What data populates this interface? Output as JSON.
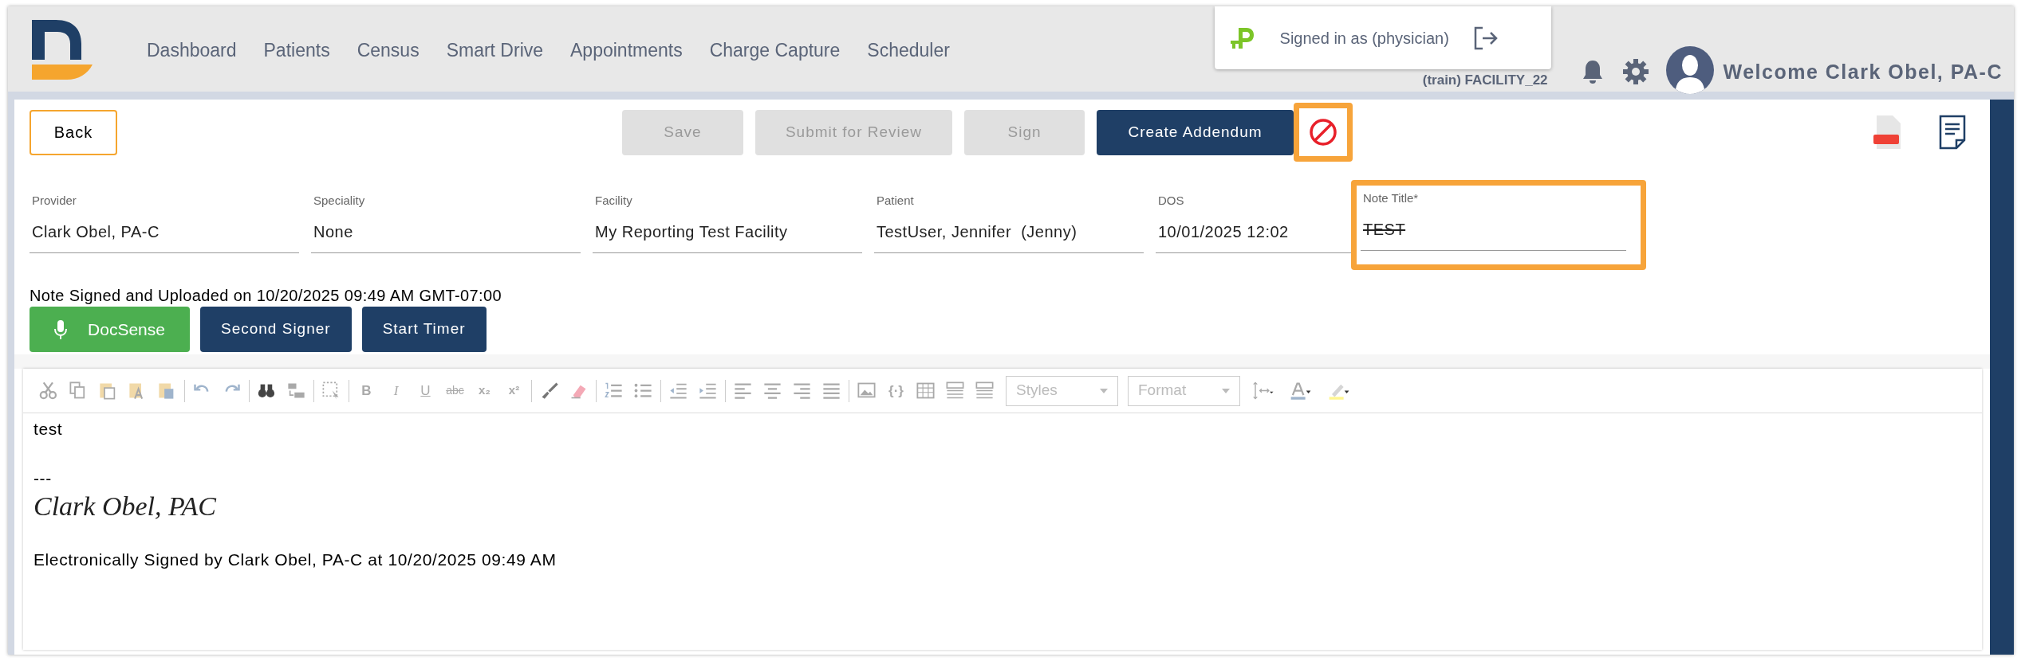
{
  "header": {
    "nav": [
      {
        "label": "Dashboard"
      },
      {
        "label": "Patients"
      },
      {
        "label": "Census"
      },
      {
        "label": "Smart Drive"
      },
      {
        "label": "Appointments"
      },
      {
        "label": "Charge Capture"
      },
      {
        "label": "Scheduler"
      }
    ],
    "signed_in": "Signed in as (physician)",
    "facility": "(train) FACILITY_22",
    "welcome": "Welcome Clark Obel, PA-C"
  },
  "actions": {
    "back": "Back",
    "buttons": [
      {
        "label": "Save",
        "disabled": true
      },
      {
        "label": "Submit for Review",
        "disabled": true
      },
      {
        "label": "Sign",
        "disabled": true
      },
      {
        "label": "Create Addendum",
        "disabled": false
      }
    ],
    "ban_highlighted": true
  },
  "fields": [
    {
      "label": "Provider",
      "value": "Clark Obel, PA-C",
      "highlighted": false,
      "struck": false
    },
    {
      "label": "Speciality",
      "value": "None",
      "highlighted": false,
      "struck": false
    },
    {
      "label": "Facility",
      "value": "My Reporting Test Facility",
      "highlighted": false,
      "struck": false
    },
    {
      "label": "Patient",
      "value": "TestUser, Jennifer  (Jenny)",
      "highlighted": false,
      "struck": false
    },
    {
      "label": "DOS",
      "value": "10/01/2025 12:02",
      "highlighted": false,
      "struck": false
    },
    {
      "label": "Note Title*",
      "value": "TEST",
      "highlighted": true,
      "struck": true
    }
  ],
  "status": "Note Signed and Uploaded on 10/20/2025 09:49 AM GMT-07:00",
  "tools": [
    {
      "label": "DocSense",
      "kind": "mic"
    },
    {
      "label": "Second Signer",
      "kind": "plain"
    },
    {
      "label": "Start Timer",
      "kind": "plain"
    }
  ],
  "editor": {
    "glyphs": [
      "B",
      "I",
      "U",
      "abc",
      "x₂",
      "x²",
      "{·}"
    ],
    "styles": "Styles",
    "format": "Format",
    "lines": [
      {
        "kind": "text",
        "text": "test"
      },
      {
        "kind": "blank"
      },
      {
        "kind": "text",
        "text": "---"
      },
      {
        "kind": "signature",
        "text": "Clark Obel, PAC"
      },
      {
        "kind": "blank"
      },
      {
        "kind": "text",
        "text": "Electronically Signed by Clark Obel, PA-C at 10/20/2025 09:49 AM"
      }
    ]
  }
}
